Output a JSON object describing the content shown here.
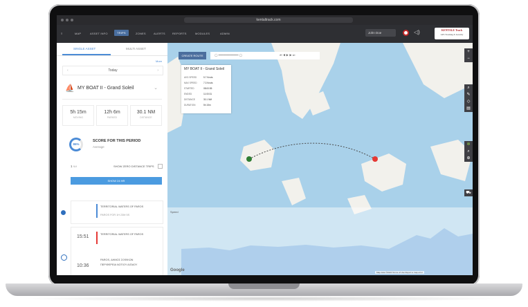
{
  "browser": {
    "url": "kentaltrack.com"
  },
  "nav": {
    "items": [
      "MAP",
      "ASSET INFO",
      "TRIPS",
      "ZONES",
      "ALERTS",
      "REPORTS",
      "MODULES",
      "ADMIN"
    ],
    "active": "TRIPS",
    "user": "John Doe",
    "logo_line1": "KENTALE Track",
    "logo_line2": "GPS Tracking & Security"
  },
  "sidebar": {
    "tabs": {
      "single": "SINGLE ASSET",
      "multi": "MULTI ASSET"
    },
    "more": "More",
    "day": "Today",
    "boat": "MY BOAT II - Grand Soleil",
    "stats": [
      {
        "value": "5h 15m",
        "label": "MOVING"
      },
      {
        "value": "12h 6m",
        "label": "PARKED"
      },
      {
        "value": "30.1 NM",
        "label": "DISTANCE"
      }
    ],
    "score_pct": "86%",
    "score_title": "SCORE FOR THIS PERIOD",
    "score_sub": "Average",
    "filter_value": "1",
    "filter_unit": "NM",
    "filter_label": "SHOW ZERO DISTANCE TRIPS",
    "show_btn": "SHOW 24 HR",
    "trips": [
      {
        "time": "",
        "name": "TERRITORIAL WATERS OF PAROS",
        "sub": "PAROS FOR 1H 23M 5S"
      },
      {
        "time": "15:51",
        "name": "TERRITORIAL WATERS OF PAROS",
        "sub": ""
      },
      {
        "time": "10:36",
        "name": "PAROS, ΔΗΜΟΣ ΣΟΦΙΚΩΝ",
        "sub": "ΠΕΡΙΦΕΡΕΙΑ ΝΟΤΙΟΥ ΑΙΓΑΙΟΥ"
      }
    ]
  },
  "map": {
    "create_route": "CREATE ROUTE",
    "panel_title": "MY BOAT II - Grand Soleil",
    "panel_rows": [
      {
        "label": "AVG SPEED",
        "value": "5.7 Knots"
      },
      {
        "label": "MAX SPEED",
        "value": "7.3 Knots"
      },
      {
        "label": "STARTED",
        "value": "08:00:55"
      },
      {
        "label": "ENDED",
        "value": "11:00:31"
      },
      {
        "label": "DISTANCE",
        "value": "30.1 NM"
      },
      {
        "label": "DURATION",
        "value": "5h 15m"
      }
    ],
    "speed_label": "Speed",
    "google": "Google",
    "attribution": "Map data ©2024   Terms of Use   Report a map error"
  }
}
